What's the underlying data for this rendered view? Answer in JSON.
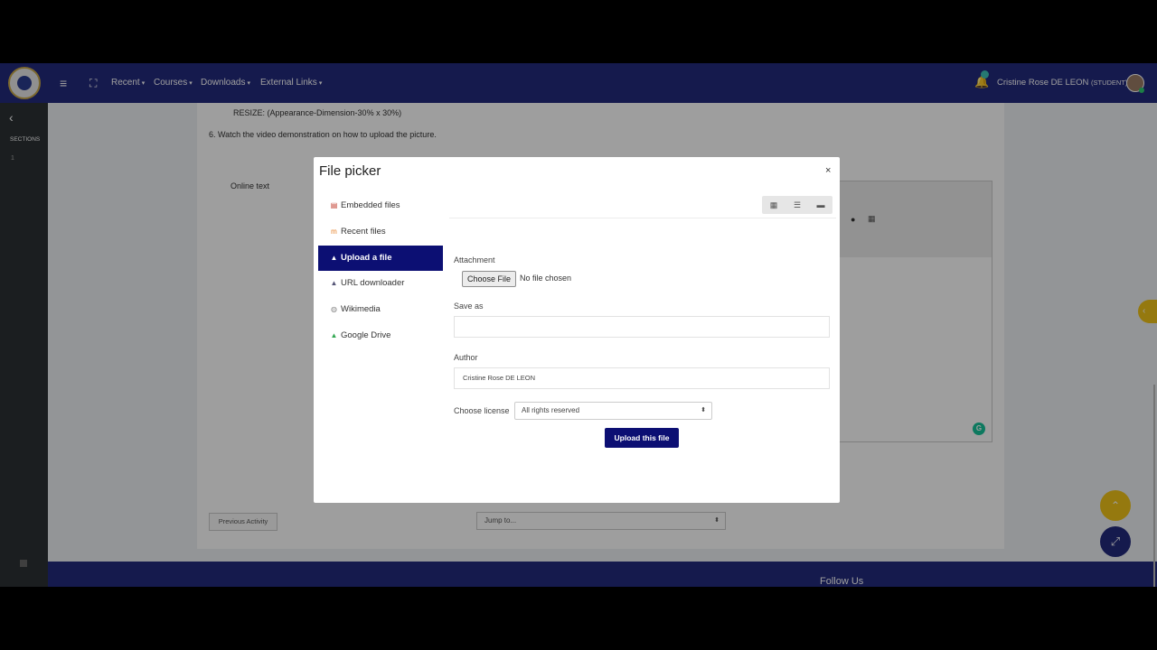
{
  "navbar": {
    "menus": [
      {
        "label": "Recent"
      },
      {
        "label": "Courses"
      },
      {
        "label": "Downloads"
      },
      {
        "label": "External Links"
      }
    ],
    "user_name": "Cristine Rose DE LEON",
    "user_role": "(STUDENT)"
  },
  "sidebar": {
    "title": "SECTIONS",
    "section_number": "1"
  },
  "page": {
    "resize_text": "RESIZE: (Appearance-Dimension-30% x 30%)",
    "step_text": "6. Watch the video demonstration on how to upload the picture.",
    "online_text_label": "Online text",
    "prev_activity": "Previous Activity",
    "jump_to": "Jump to...",
    "footer_heading": "Follow Us"
  },
  "file_picker": {
    "title": "File picker",
    "close": "×",
    "repositories": [
      {
        "label": "Embedded files",
        "icon": "embedded-files-icon"
      },
      {
        "label": "Recent files",
        "icon": "recent-files-icon"
      },
      {
        "label": "Upload a file",
        "icon": "upload-icon",
        "active": true
      },
      {
        "label": "URL downloader",
        "icon": "url-downloader-icon"
      },
      {
        "label": "Wikimedia",
        "icon": "wikimedia-icon"
      },
      {
        "label": "Google Drive",
        "icon": "google-drive-icon"
      }
    ],
    "attachment_label": "Attachment",
    "choose_file_button": "Choose File",
    "file_status": "No file chosen",
    "save_as_label": "Save as",
    "save_as_value": "",
    "author_label": "Author",
    "author_value": "Cristine Rose DE LEON",
    "license_label": "Choose license",
    "license_value": "All rights reserved",
    "upload_button": "Upload this file"
  },
  "colors": {
    "navbar": "#232a7d",
    "active_item": "#0c0f73",
    "accent_yellow": "#f0c419"
  }
}
